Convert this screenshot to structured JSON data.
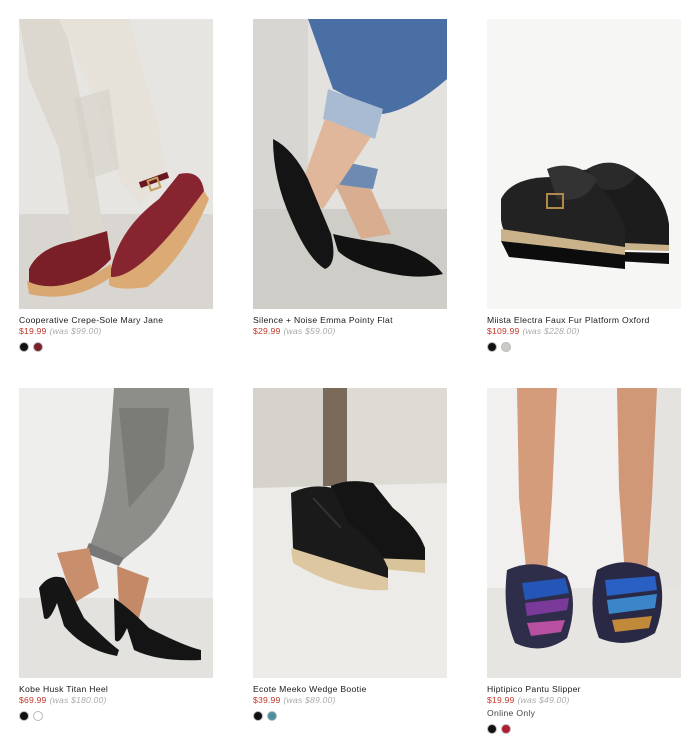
{
  "products": [
    {
      "name": "Cooperative Crepe-Sole Mary Jane",
      "sale_price": "$19.99",
      "was_price": "(was $99.00)",
      "online_only": "",
      "swatches": [
        {
          "color": "#111111",
          "name": "black"
        },
        {
          "color": "#7a2028",
          "name": "burgundy"
        }
      ]
    },
    {
      "name": "Silence + Noise Emma Pointy Flat",
      "sale_price": "$29.99",
      "was_price": "(was $59.00)",
      "online_only": "",
      "swatches": []
    },
    {
      "name": "Miista Electra Faux Fur Platform Oxford",
      "sale_price": "$109.99",
      "was_price": "(was $228.00)",
      "online_only": "",
      "swatches": [
        {
          "color": "#111111",
          "name": "black"
        },
        {
          "color": "#c9cbc5",
          "name": "grey"
        }
      ]
    },
    {
      "name": "Kobe Husk Titan Heel",
      "sale_price": "$69.99",
      "was_price": "(was $180.00)",
      "online_only": "",
      "swatches": [
        {
          "color": "#111111",
          "name": "black"
        },
        {
          "color": "#ffffff",
          "name": "white"
        }
      ]
    },
    {
      "name": "Ecote Meeko Wedge Bootie",
      "sale_price": "$39.99",
      "was_price": "(was $89.00)",
      "online_only": "",
      "swatches": [
        {
          "color": "#111111",
          "name": "black"
        },
        {
          "color": "#4d8fa0",
          "name": "teal"
        }
      ]
    },
    {
      "name": "Hiptipico Pantu Slipper",
      "sale_price": "$19.99",
      "was_price": "(was $49.00)",
      "online_only": "Online Only",
      "swatches": [
        {
          "color": "#111111",
          "name": "black"
        },
        {
          "color": "#b01c34",
          "name": "red"
        }
      ]
    }
  ]
}
